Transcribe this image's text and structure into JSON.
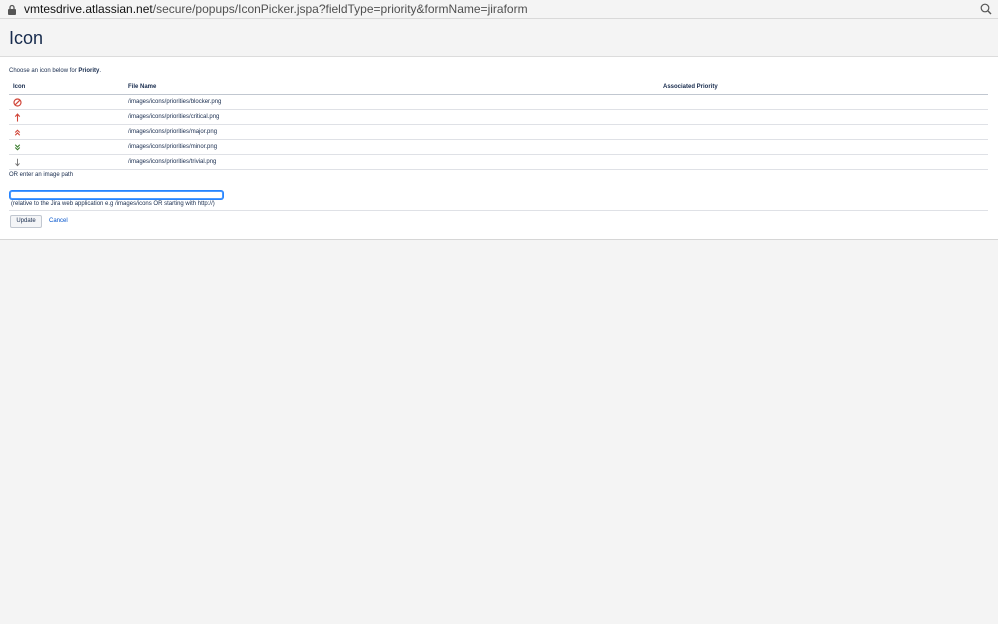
{
  "browser": {
    "url_host": "vmtesdrive.atlassian.net",
    "url_path": "/secure/popups/IconPicker.jspa?fieldType=priority&formName=jiraform"
  },
  "page": {
    "title": "Icon",
    "intro_prefix": "Choose an icon below for ",
    "intro_field": "Priority",
    "intro_suffix": "."
  },
  "table": {
    "headers": [
      "Icon",
      "File Name",
      "Associated Priority"
    ],
    "rows": [
      {
        "icon": "blocker-icon",
        "file": "/images/icons/priorities/blocker.png",
        "priority": ""
      },
      {
        "icon": "critical-icon",
        "file": "/images/icons/priorities/critical.png",
        "priority": ""
      },
      {
        "icon": "major-icon",
        "file": "/images/icons/priorities/major.png",
        "priority": ""
      },
      {
        "icon": "minor-icon",
        "file": "/images/icons/priorities/minor.png",
        "priority": ""
      },
      {
        "icon": "trivial-icon",
        "file": "/images/icons/priorities/trivial.png",
        "priority": ""
      }
    ]
  },
  "form": {
    "or_text": "OR enter an image path",
    "path_value": "",
    "hint": "(relative to the Jira web application e.g /images/icons OR starting with http://)",
    "update_label": "Update",
    "cancel_label": "Cancel"
  },
  "colors": {
    "text": "#172b4d",
    "link": "#0052cc",
    "blocker": "#d04437",
    "critical": "#d04437",
    "minor": "#3b7e2e",
    "trivial": "#707070"
  }
}
